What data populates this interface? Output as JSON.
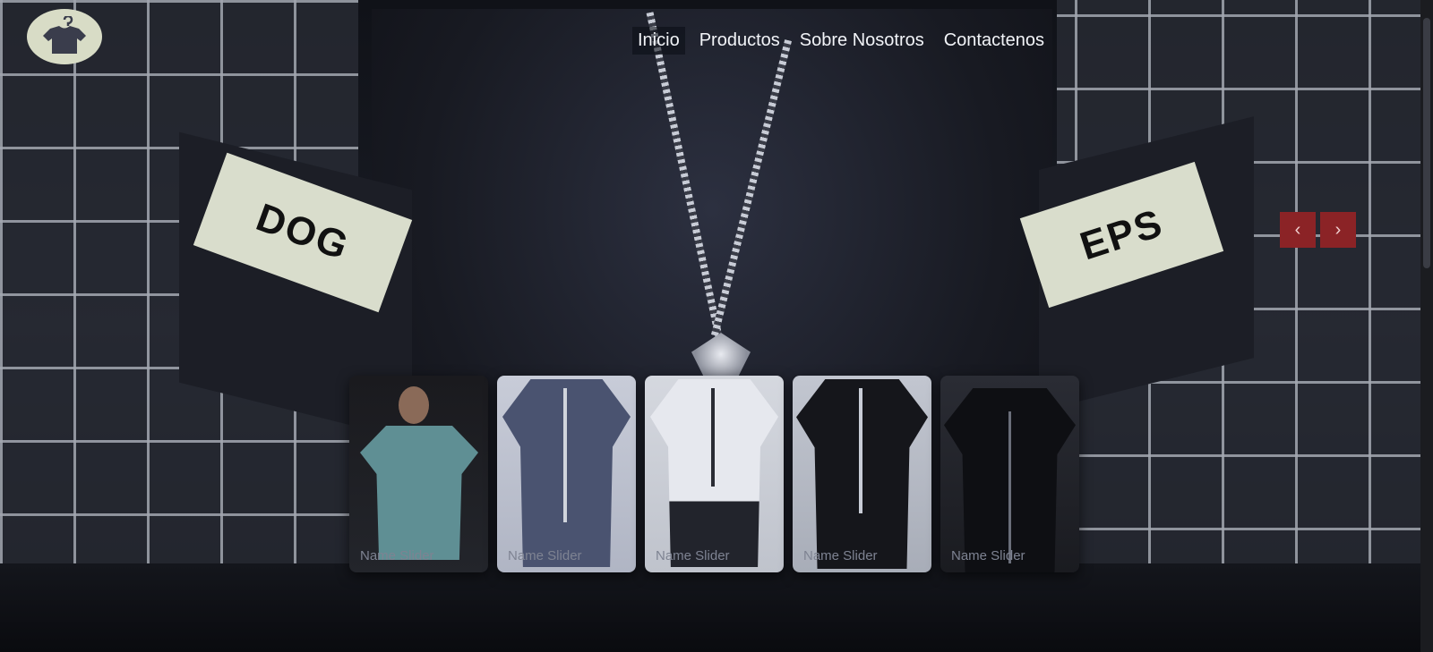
{
  "brand": {
    "logo_icon": "hanger-shirt-icon",
    "logo_color": "#d8dcc6"
  },
  "nav": {
    "items": [
      {
        "label": "Inicio",
        "active": true
      },
      {
        "label": "Productos",
        "active": false
      },
      {
        "label": "Sobre Nosotros",
        "active": false
      },
      {
        "label": "Contactenos",
        "active": false
      }
    ]
  },
  "hero": {
    "sleeve_left_text": "DOG",
    "sleeve_right_text": "EPS",
    "prev_icon": "chevron-left-icon",
    "next_icon": "chevron-right-icon",
    "prev_glyph": "‹",
    "next_glyph": "›",
    "arrow_color": "#8b2326"
  },
  "slider": {
    "thumbs": [
      {
        "caption": "Name Slider"
      },
      {
        "caption": "Name Slider"
      },
      {
        "caption": "Name Slider"
      },
      {
        "caption": "Name Slider"
      },
      {
        "caption": "Name Slider"
      }
    ]
  }
}
